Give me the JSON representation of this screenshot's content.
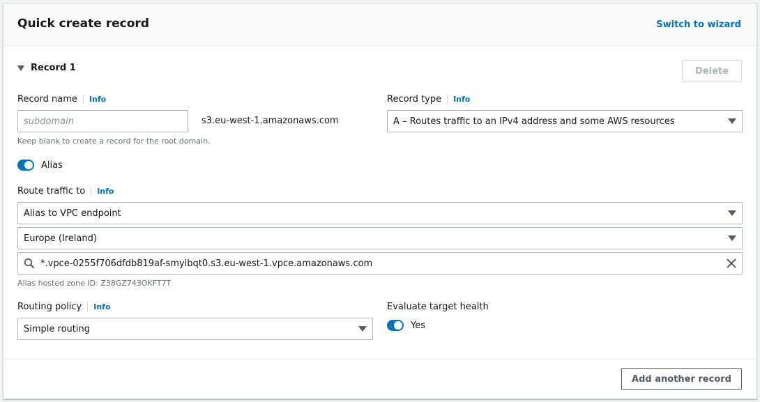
{
  "header": {
    "title": "Quick create record",
    "switch_label": "Switch to wizard"
  },
  "record": {
    "toggle_label": "Record 1",
    "delete_label": "Delete",
    "name_label": "Record name",
    "name_info": "Info",
    "name_placeholder": "subdomain",
    "domain_suffix": "s3.eu-west-1.amazonaws.com",
    "name_hint": "Keep blank to create a record for the root domain.",
    "type_label": "Record type",
    "type_info": "Info",
    "type_value": "A – Routes traffic to an IPv4 address and some AWS resources",
    "alias_label": "Alias",
    "alias_on": true
  },
  "route": {
    "label": "Route traffic to",
    "info": "Info",
    "target_value": "Alias to VPC endpoint",
    "region_value": "Europe (Ireland)",
    "endpoint_value": "*.vpce-0255f706dfdb819af-smyibqt0.s3.eu-west-1.vpce.amazonaws.com",
    "zone_hint": "Alias hosted zone ID: Z38GZ743OKFT7T"
  },
  "routing": {
    "label": "Routing policy",
    "info": "Info",
    "value": "Simple routing",
    "health_label": "Evaluate target health",
    "health_toggle_label": "Yes",
    "health_on": true
  },
  "footer": {
    "add_label": "Add another record"
  },
  "colors": {
    "accent": "#0073bb",
    "text": "#16191f",
    "muted": "#687078"
  }
}
